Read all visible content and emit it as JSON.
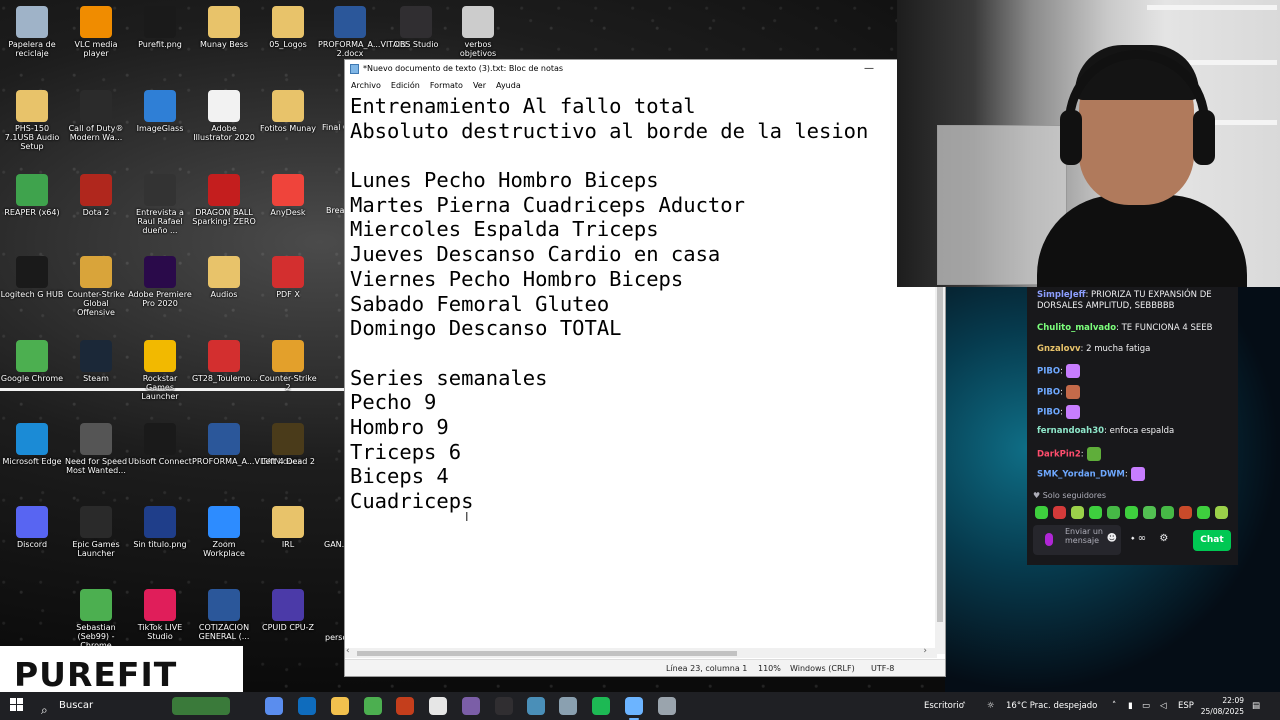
{
  "desktop": {
    "icons": [
      {
        "label": "Papelera de reciclaje",
        "icon": "recycle-bin-icon",
        "color": "#9fb3c8"
      },
      {
        "label": "VLC media player",
        "icon": "vlc-icon",
        "color": "#f08c00"
      },
      {
        "label": "Purefit.png",
        "icon": "image-file-icon",
        "color": "#1a1a1a"
      },
      {
        "label": "Munay Bess",
        "icon": "folder-icon",
        "color": "#e8c36a"
      },
      {
        "label": "05_Logos",
        "icon": "folder-icon",
        "color": "#e8c36a"
      },
      {
        "label": "PROFORMA_A...VITAIN 2.docx",
        "icon": "word-icon",
        "color": "#2b579a"
      },
      {
        "label": "OBS Studio",
        "icon": "obs-icon",
        "color": "#302e31"
      },
      {
        "label": "verbos objetivos especificos .png",
        "icon": "image-file-icon",
        "color": "#cccccc"
      },
      {
        "label": "PHS-150 7.1USB Audio Setup",
        "icon": "folder-icon",
        "color": "#e8c36a"
      },
      {
        "label": "Call of Duty® Modern Wa...",
        "icon": "cod-icon",
        "color": "#2b2b2b"
      },
      {
        "label": "ImageGlass",
        "icon": "imageglass-icon",
        "color": "#2f7fd6"
      },
      {
        "label": "Adobe Illustrator 2020",
        "icon": "file-icon",
        "color": "#f2f2f2"
      },
      {
        "label": "Fotitos Munay",
        "icon": "folder-icon",
        "color": "#e8c36a"
      },
      {
        "label": "REAPER (x64)",
        "icon": "reaper-icon",
        "color": "#3fa34d"
      },
      {
        "label": "Dota 2",
        "icon": "dota-icon",
        "color": "#b0271d"
      },
      {
        "label": "Entrevista a Raul Rafael dueño ...",
        "icon": "video-file-icon",
        "color": "#333333"
      },
      {
        "label": "DRAGON BALL Sparking! ZERO",
        "icon": "dragonball-icon",
        "color": "#c41e1e"
      },
      {
        "label": "AnyDesk",
        "icon": "anydesk-icon",
        "color": "#ef443b"
      },
      {
        "label": "Logitech G HUB",
        "icon": "logitech-icon",
        "color": "#1a1a1a"
      },
      {
        "label": "Counter-Strike Global Offensive",
        "icon": "csgo-icon",
        "color": "#d9a43a"
      },
      {
        "label": "Adobe Premiere Pro 2020",
        "icon": "premiere-icon",
        "color": "#2a0a4a"
      },
      {
        "label": "Audios",
        "icon": "folder-icon",
        "color": "#e8c36a"
      },
      {
        "label": "PDF X",
        "icon": "pdfx-icon",
        "color": "#d32f2f"
      },
      {
        "label": "Google Chrome",
        "icon": "chrome-icon",
        "color": "#4caf50"
      },
      {
        "label": "Steam",
        "icon": "steam-icon",
        "color": "#1b2838"
      },
      {
        "label": "Rockstar Games Launcher",
        "icon": "rockstar-icon",
        "color": "#f2b900"
      },
      {
        "label": "GT28_Toulemo...",
        "icon": "pdf-icon",
        "color": "#d32f2f"
      },
      {
        "label": "Counter-Strike 2",
        "icon": "cs2-icon",
        "color": "#e3a02b"
      },
      {
        "label": "Microsoft Edge",
        "icon": "edge-icon",
        "color": "#1b8bd6"
      },
      {
        "label": "Need for Speed Most Wanted...",
        "icon": "nfs-icon",
        "color": "#555555"
      },
      {
        "label": "Ubisoft Connect",
        "icon": "ubisoft-icon",
        "color": "#1a1a1a"
      },
      {
        "label": "PROFORMA_A...VITAIN.docx",
        "icon": "word-icon",
        "color": "#2b579a"
      },
      {
        "label": "Left 4 Dead 2",
        "icon": "l4d2-icon",
        "color": "#4a3b1a"
      },
      {
        "label": "Discord",
        "icon": "discord-icon",
        "color": "#5865f2"
      },
      {
        "label": "Epic Games Launcher",
        "icon": "epic-icon",
        "color": "#2a2a2a"
      },
      {
        "label": "Sin titulo.png",
        "icon": "image-file-icon",
        "color": "#1f3e8a"
      },
      {
        "label": "Zoom Workplace",
        "icon": "zoom-icon",
        "color": "#2d8cff"
      },
      {
        "label": "IRL",
        "icon": "folder-icon",
        "color": "#e8c36a"
      },
      {
        "label": "Sebastian (Seb99) - Chrome",
        "icon": "chrome-icon",
        "color": "#4caf50"
      },
      {
        "label": "TikTok LIVE Studio",
        "icon": "tiktok-icon",
        "color": "#e01e5a"
      },
      {
        "label": "COTIZACION GENERAL (...",
        "icon": "word-icon",
        "color": "#2b579a"
      },
      {
        "label": "CPUID CPU-Z",
        "icon": "cpuz-icon",
        "color": "#4b3aa8"
      }
    ],
    "partial_labels": [
      "Final C... Pul...",
      "Brea...",
      "GAN...",
      "perso..."
    ]
  },
  "notepad": {
    "title": "*Nuevo documento de texto (3).txt: Bloc de notas",
    "minimize": "—",
    "menu": [
      "Archivo",
      "Edición",
      "Formato",
      "Ver",
      "Ayuda"
    ],
    "lines": [
      "Entrenamiento Al fallo total",
      "Absoluto destructivo al borde de la lesion",
      "",
      "Lunes Pecho Hombro Biceps",
      "Martes Pierna Cuadriceps Aductor",
      "Miercoles Espalda Triceps",
      "Jueves Descanso Cardio en casa",
      "Viernes Pecho Hombro Biceps",
      "Sabado Femoral Gluteo",
      "Domingo Descanso TOTAL",
      "",
      "Series semanales",
      "Pecho 9",
      "Hombro 9",
      "Triceps 6",
      "Biceps 4",
      "Cuadriceps"
    ],
    "status": {
      "position": "Línea 23, columna 1",
      "zoom": "110%",
      "line_ending": "Windows (CRLF)",
      "encoding": "UTF-8"
    }
  },
  "chat": {
    "messages": [
      {
        "user": "SimpleJeff",
        "color": "#8c9eff",
        "text": ": PRIORIZA TU EXPANSIÓN DE DORSALES AMPLITUD, SEBBBBB"
      },
      {
        "user": "Chulito_malvado",
        "color": "#7cff7c",
        "text": ": TE FUNCIONA 4 SEEB"
      },
      {
        "user": "Gnzalovv",
        "color": "#e8c36a",
        "text": ": 2 mucha fatiga"
      },
      {
        "user": "PIBO",
        "color": "#6ea8ff",
        "text": ":",
        "emote": "#c77dff"
      },
      {
        "user": "PIBO",
        "color": "#6ea8ff",
        "text": ":",
        "emote": "#c46a4a"
      },
      {
        "user": "PIBO",
        "color": "#6ea8ff",
        "text": ":",
        "emote": "#c77dff"
      },
      {
        "user": "fernandoah30",
        "color": "#8ee6c9",
        "text": ": enfoca espalda"
      },
      {
        "user": "DarkPin2",
        "color": "#ff4d6d",
        "text": ":",
        "emote": "#5fae3a"
      },
      {
        "user": "SMK_Yordan_DWM",
        "color": "#6ea8ff",
        "text": ":",
        "emote": "#c77dff"
      }
    ],
    "followers_only": "Solo seguidores",
    "emotes": [
      "#3ecf3e",
      "#d43a3a",
      "#9bd14a",
      "#3ecf3e",
      "#46b946",
      "#3ecf3e",
      "#52c052",
      "#46b946",
      "#c94a2a",
      "#3ecf3e",
      "#9bd14a"
    ],
    "input_placeholder": "Enviar un mensaje",
    "send_button": "Chat",
    "accent": "#00c853"
  },
  "overlay": {
    "brand": "PUREFIT"
  },
  "taskbar": {
    "search_label": "Buscar",
    "apps": [
      {
        "name": "widget-thumb",
        "color": "#3a7a3a"
      },
      {
        "name": "task-view",
        "color": "#1f2024"
      },
      {
        "name": "copilot",
        "color": "#5a8dee"
      },
      {
        "name": "outlook",
        "color": "#0f6cbd"
      },
      {
        "name": "file-explorer",
        "color": "#f2c14e"
      },
      {
        "name": "chrome",
        "color": "#4caf50"
      },
      {
        "name": "powerpoint",
        "color": "#c43e1c"
      },
      {
        "name": "notepad-file",
        "color": "#e6e6e6"
      },
      {
        "name": "obs",
        "color": "#7b5ea7"
      },
      {
        "name": "obs-studio",
        "color": "#302e31"
      },
      {
        "name": "app-window",
        "color": "#4a8fb8"
      },
      {
        "name": "vpn",
        "color": "#8aa0b0"
      },
      {
        "name": "spotify",
        "color": "#1db954"
      },
      {
        "name": "notepad",
        "color": "#6cb4ff"
      },
      {
        "name": "remote",
        "color": "#9aa4ad"
      }
    ],
    "desktop_label": "Escritorio",
    "weather": "16°C  Prac. despejado",
    "language": "ESP",
    "time": "22:09",
    "date": "25/08/2025"
  }
}
